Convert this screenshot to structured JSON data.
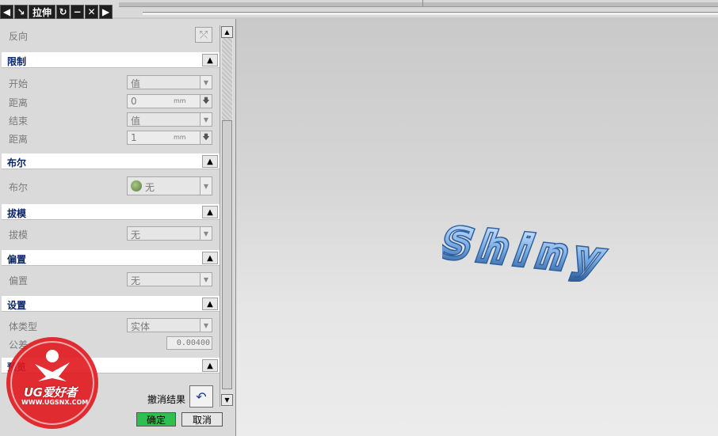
{
  "dialog": {
    "title": "拉伸",
    "reverse": {
      "label": "反向"
    },
    "sections": {
      "limit": {
        "title": "限制",
        "start": {
          "label": "开始",
          "value": "值"
        },
        "start_distance": {
          "label": "距离",
          "value": "0",
          "unit": "mm"
        },
        "end": {
          "label": "结束",
          "value": "值"
        },
        "end_distance": {
          "label": "距离",
          "value": "1",
          "unit": "mm"
        }
      },
      "boolean": {
        "title": "布尔",
        "label": "布尔",
        "value": "无"
      },
      "draft": {
        "title": "拔模",
        "label": "拔模",
        "value": "无"
      },
      "offset": {
        "title": "偏置",
        "label": "偏置",
        "value": "无"
      },
      "settings": {
        "title": "设置",
        "body_type": {
          "label": "体类型",
          "value": "实体"
        },
        "tolerance": {
          "label": "公差",
          "value": "0.00400"
        }
      },
      "preview": {
        "title": "预览",
        "undo_label": "撤消结果"
      }
    },
    "ok_label": "确定",
    "cancel_label": "取消"
  },
  "watermark": {
    "brand": "UG爱好者",
    "url": "WWW.UGSNX.COM"
  },
  "viewport": {
    "model_text": "Shiny",
    "model_color": "#7aaee6"
  }
}
